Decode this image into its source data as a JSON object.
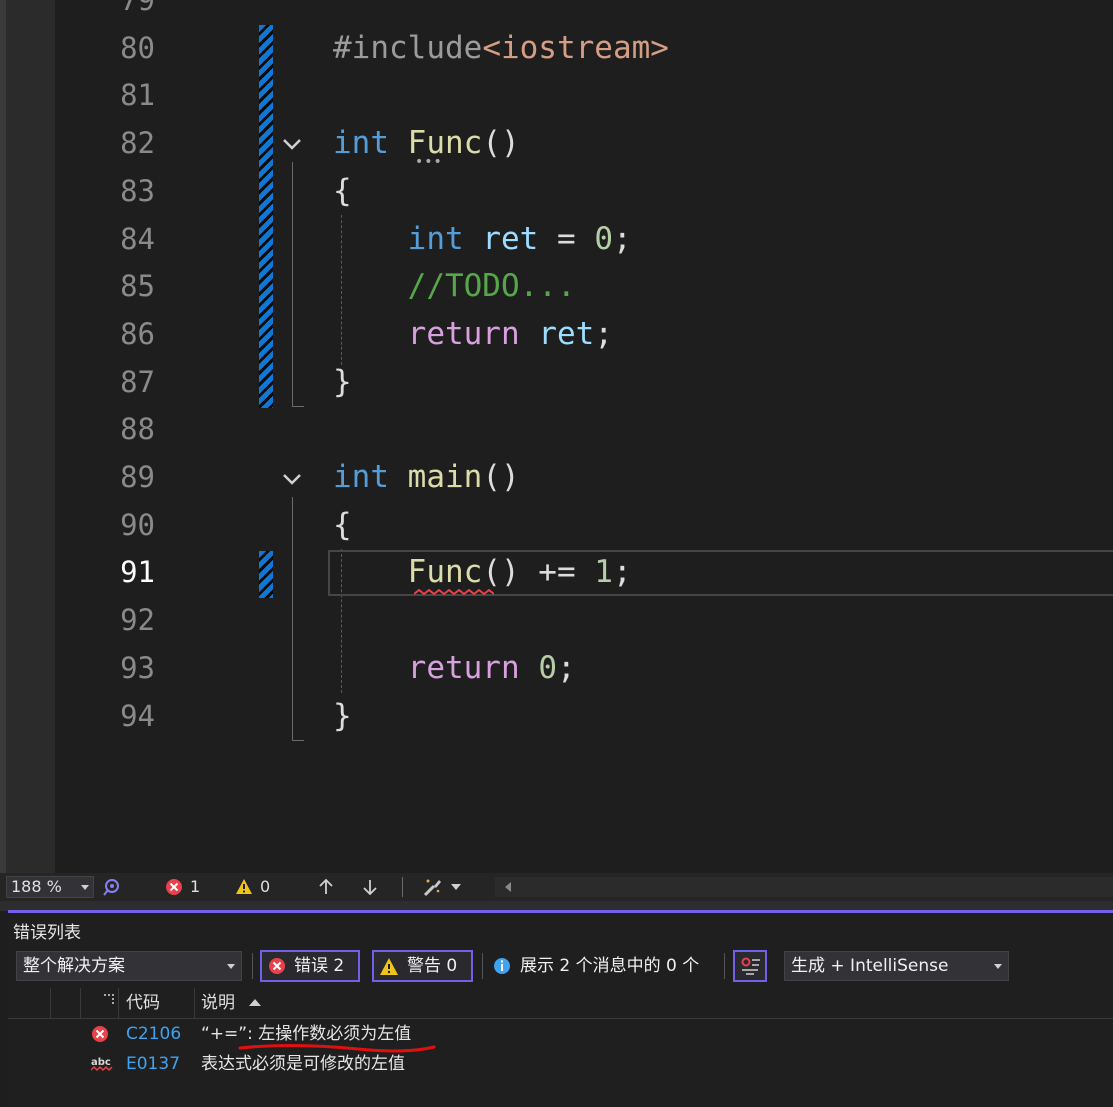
{
  "editor": {
    "lines": [
      {
        "num": "79",
        "current": false
      },
      {
        "num": "80",
        "current": false,
        "segments": [
          {
            "t": "#include",
            "c": "pp"
          },
          {
            "t": "<iostream>",
            "c": "str"
          }
        ]
      },
      {
        "num": "81",
        "current": false
      },
      {
        "num": "82",
        "current": false,
        "segments": [
          {
            "t": "int",
            "c": "kw"
          },
          {
            "t": " ",
            "c": ""
          },
          {
            "t": "Func",
            "c": "fn"
          },
          {
            "t": "()",
            "c": ""
          }
        ]
      },
      {
        "num": "83",
        "current": false,
        "segments": [
          {
            "t": "{",
            "c": ""
          }
        ]
      },
      {
        "num": "84",
        "current": false,
        "segments": [
          {
            "t": "    ",
            "c": ""
          },
          {
            "t": "int",
            "c": "kw"
          },
          {
            "t": " ",
            "c": ""
          },
          {
            "t": "ret",
            "c": "var"
          },
          {
            "t": " = ",
            "c": ""
          },
          {
            "t": "0",
            "c": "num"
          },
          {
            "t": ";",
            "c": ""
          }
        ]
      },
      {
        "num": "85",
        "current": false,
        "segments": [
          {
            "t": "    ",
            "c": ""
          },
          {
            "t": "//TODO...",
            "c": "cmt"
          }
        ]
      },
      {
        "num": "86",
        "current": false,
        "segments": [
          {
            "t": "    ",
            "c": ""
          },
          {
            "t": "return",
            "c": "kw2"
          },
          {
            "t": " ",
            "c": ""
          },
          {
            "t": "ret",
            "c": "var"
          },
          {
            "t": ";",
            "c": ""
          }
        ]
      },
      {
        "num": "87",
        "current": false,
        "segments": [
          {
            "t": "}",
            "c": ""
          }
        ]
      },
      {
        "num": "88",
        "current": false
      },
      {
        "num": "89",
        "current": false,
        "segments": [
          {
            "t": "int",
            "c": "kw"
          },
          {
            "t": " ",
            "c": ""
          },
          {
            "t": "main",
            "c": "fn"
          },
          {
            "t": "()",
            "c": ""
          }
        ]
      },
      {
        "num": "90",
        "current": false,
        "segments": [
          {
            "t": "{",
            "c": ""
          }
        ]
      },
      {
        "num": "91",
        "current": true,
        "segments": [
          {
            "t": "    ",
            "c": ""
          },
          {
            "t": "Func",
            "c": "fn"
          },
          {
            "t": "() += ",
            "c": ""
          },
          {
            "t": "1",
            "c": "num"
          },
          {
            "t": ";",
            "c": ""
          }
        ]
      },
      {
        "num": "92",
        "current": false
      },
      {
        "num": "93",
        "current": false,
        "segments": [
          {
            "t": "    ",
            "c": ""
          },
          {
            "t": "return",
            "c": "kw2"
          },
          {
            "t": " ",
            "c": ""
          },
          {
            "t": "0",
            "c": "num"
          },
          {
            "t": ";",
            "c": ""
          }
        ]
      },
      {
        "num": "94",
        "current": false,
        "segments": [
          {
            "t": "}",
            "c": ""
          }
        ]
      }
    ]
  },
  "status": {
    "zoom": "188 %",
    "errors": "1",
    "warnings": "0"
  },
  "error_list": {
    "title": "错误列表",
    "scope": "整个解决方案",
    "errors_button": "错误 2",
    "warnings_button": "警告 0",
    "messages_button": "展示 2 个消息中的 0 个",
    "source": "生成 + IntelliSense",
    "columns": {
      "code": "代码",
      "description": "说明"
    },
    "rows": [
      {
        "code": "C2106",
        "description": "“+=”: 左操作数必须为左值",
        "icon": "error-icon"
      },
      {
        "code": "E0137",
        "description": "表达式必须是可修改的左值",
        "icon": "spellcheck-icon"
      }
    ]
  },
  "colors": {
    "accent": "#7160e8",
    "error": "#e8414b",
    "warning": "#f0c419",
    "link": "#3ea3f0"
  }
}
